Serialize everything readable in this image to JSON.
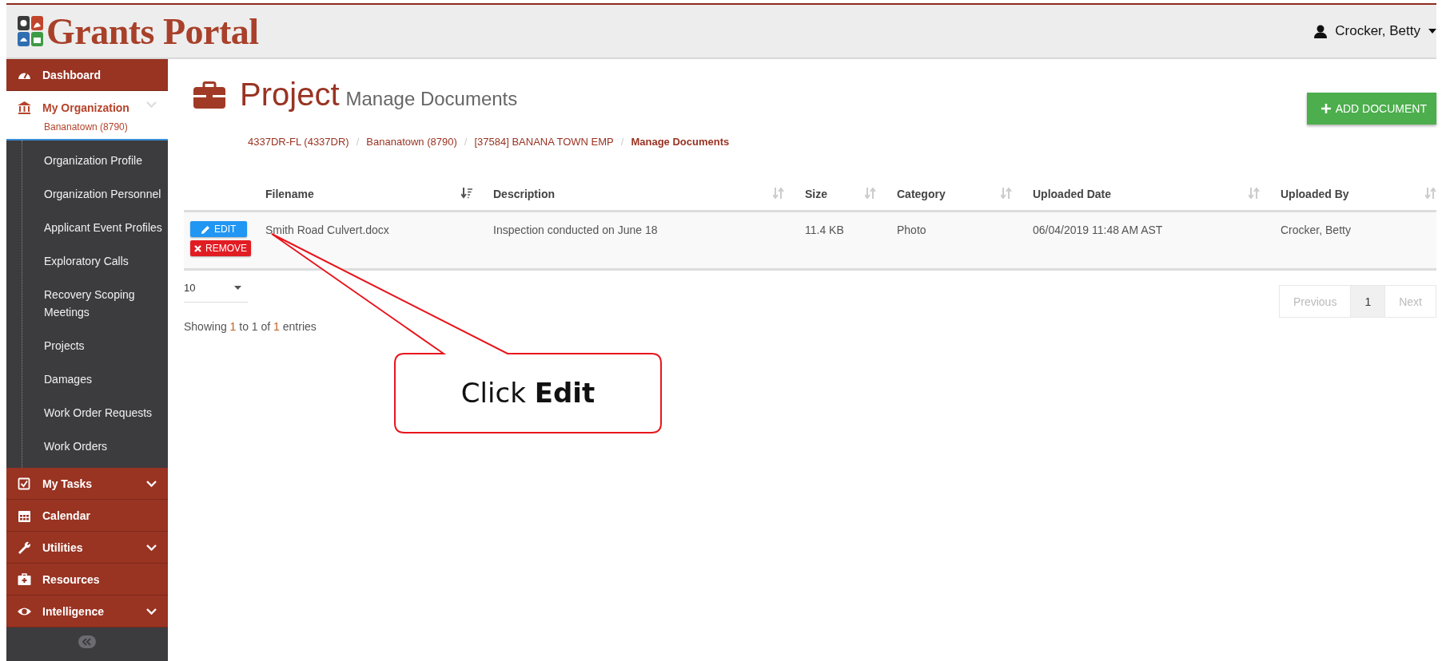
{
  "header": {
    "logo_text": "Grants Portal",
    "user": "Crocker, Betty"
  },
  "sidebar": {
    "items": [
      {
        "label": "Dashboard"
      },
      {
        "label": "My Organization",
        "sublabel": "Bananatown (8790)",
        "expanded": true,
        "children": [
          {
            "label": "Organization Profile"
          },
          {
            "label": "Organization Personnel"
          },
          {
            "label": "Applicant Event Profiles"
          },
          {
            "label": "Exploratory Calls"
          },
          {
            "label": "Recovery Scoping Meetings"
          },
          {
            "label": "Projects"
          },
          {
            "label": "Damages"
          },
          {
            "label": "Work Order Requests"
          },
          {
            "label": "Work Orders"
          }
        ]
      },
      {
        "label": "My Tasks",
        "expanded": false
      },
      {
        "label": "Calendar"
      },
      {
        "label": "Utilities",
        "expanded": false
      },
      {
        "label": "Resources"
      },
      {
        "label": "Intelligence",
        "expanded": false
      }
    ]
  },
  "page": {
    "title": "Project",
    "subtitle": "Manage Documents",
    "breadcrumb_separator": "/",
    "breadcrumbs": [
      {
        "label": "4337DR-FL (4337DR)",
        "current": false
      },
      {
        "label": "Bananatown (8790)",
        "current": false
      },
      {
        "label": "[37584] BANANA TOWN EMP",
        "current": false
      },
      {
        "label": "Manage Documents",
        "current": true
      }
    ],
    "add_button": "ADD DOCUMENT"
  },
  "table": {
    "columns": [
      {
        "label": "Filename",
        "sorted": true
      },
      {
        "label": "Description",
        "sorted": false
      },
      {
        "label": "Size",
        "sorted": false
      },
      {
        "label": "Category",
        "sorted": false
      },
      {
        "label": "Uploaded Date",
        "sorted": false
      },
      {
        "label": "Uploaded By",
        "sorted": false
      }
    ],
    "rows": [
      {
        "actions": [
          "EDIT",
          "REMOVE"
        ],
        "cells": [
          "Smith Road Culvert.docx",
          "Inspection conducted on June 18",
          "11.4 KB",
          "Photo",
          "06/04/2019 11:48 AM AST",
          "Crocker, Betty"
        ]
      }
    ],
    "page_length": "10",
    "info": "Showing *1* to 1 of *1* entries",
    "pagination": [
      {
        "label": "Previous",
        "selected": false
      },
      {
        "label": "1",
        "selected": true
      },
      {
        "label": "Next",
        "selected": false
      }
    ]
  },
  "callout": {
    "text": "Click **Edit**"
  }
}
